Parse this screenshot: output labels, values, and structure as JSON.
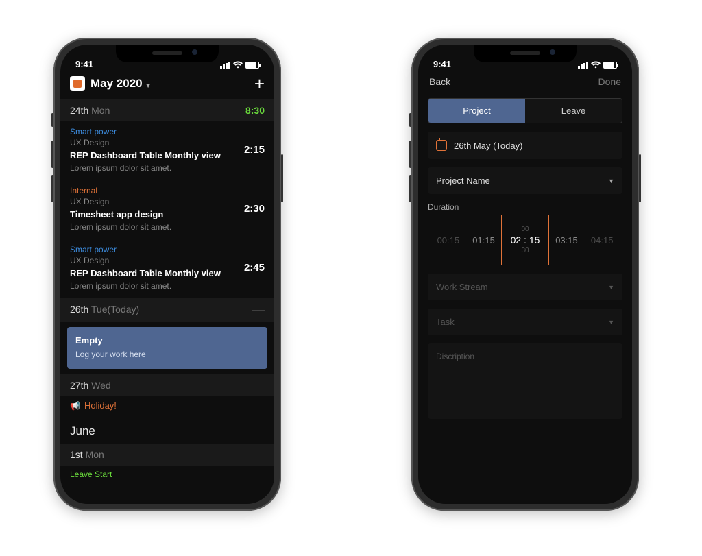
{
  "status": {
    "time": "9:41"
  },
  "left": {
    "month": "May 2020",
    "days": [
      {
        "date": "24th",
        "dow": "Mon",
        "total": "8:30"
      },
      {
        "date": "26th",
        "dow": "Tue(Today)"
      },
      {
        "date": "27th",
        "dow": "Wed"
      },
      {
        "date": "1st",
        "dow": "Mon"
      }
    ],
    "entries": [
      {
        "proj": "Smart power",
        "cat": "UX Design",
        "title": "REP Dashboard Table Monthly view",
        "desc": "Lorem ipsum dolor sit amet.",
        "time": "2:15",
        "tag": "blue"
      },
      {
        "proj": "Internal",
        "cat": "UX Design",
        "title": "Timesheet app design",
        "desc": "Lorem ipsum dolor sit amet.",
        "time": "2:30",
        "tag": "orange"
      },
      {
        "proj": "Smart power",
        "cat": "UX Design",
        "title": "REP Dashboard Table Monthly view",
        "desc": "Lorem ipsum dolor sit amet.",
        "time": "2:45",
        "tag": "blue"
      }
    ],
    "empty": {
      "title": "Empty",
      "sub": "Log your work here"
    },
    "holiday": "Holiday!",
    "next_month": "June",
    "leave": "Leave Start"
  },
  "right": {
    "back": "Back",
    "done": "Done",
    "tabs": {
      "project": "Project",
      "leave": "Leave"
    },
    "date": "26th May (Today)",
    "project_label": "Project Name",
    "duration_label": "Duration",
    "picker": {
      "opts": [
        "00:15",
        "01:15",
        "02 : 15",
        "03:15",
        "04:15"
      ],
      "above": "00",
      "below": "30"
    },
    "workstream": "Work Stream",
    "task": "Task",
    "desc_placeholder": "Discription"
  }
}
